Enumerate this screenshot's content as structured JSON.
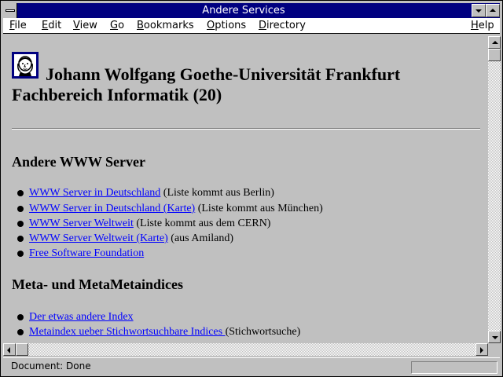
{
  "window": {
    "title": "Andere Services"
  },
  "menu": [
    {
      "label": "File",
      "key": "F",
      "rest": "ile"
    },
    {
      "label": "Edit",
      "key": "E",
      "rest": "dit"
    },
    {
      "label": "View",
      "key": "V",
      "rest": "iew"
    },
    {
      "label": "Go",
      "key": "G",
      "rest": "o"
    },
    {
      "label": "Bookmarks",
      "key": "B",
      "rest": "ookmarks"
    },
    {
      "label": "Options",
      "key": "O",
      "rest": "ptions"
    },
    {
      "label": "Directory",
      "key": "D",
      "rest": "irectory"
    },
    {
      "label": "Help",
      "key": "H",
      "rest": "elp"
    }
  ],
  "page": {
    "heading_line1": "Johann Wolfgang Goethe-Universität Frankfurt",
    "heading_line2": "Fachbereich Informatik (20)",
    "sections": [
      {
        "title": "Andere WWW Server",
        "items": [
          {
            "link": "WWW Server in Deutschland",
            "note": " (Liste kommt aus Berlin)"
          },
          {
            "link": "WWW Server in Deutschland (Karte)",
            "note": " (Liste kommt aus München)"
          },
          {
            "link": "WWW Server Weltweit",
            "note": " (Liste kommt aus dem CERN)"
          },
          {
            "link": "WWW Server Weltweit (Karte)",
            "note": " (aus Amiland)"
          },
          {
            "link": "Free Software Foundation",
            "note": ""
          }
        ]
      },
      {
        "title": "Meta- und MetaMetaindices",
        "items": [
          {
            "link": "Der etwas andere Index",
            "note": ""
          },
          {
            "link": "Metaindex ueber Stichwortsuchbare Indices ",
            "note": "(Stichwortsuche)"
          }
        ]
      }
    ]
  },
  "status": {
    "text": "Document: Done"
  },
  "colors": {
    "titlebar": "#000080",
    "link": "#0000ff",
    "background": "#c0c0c0"
  }
}
